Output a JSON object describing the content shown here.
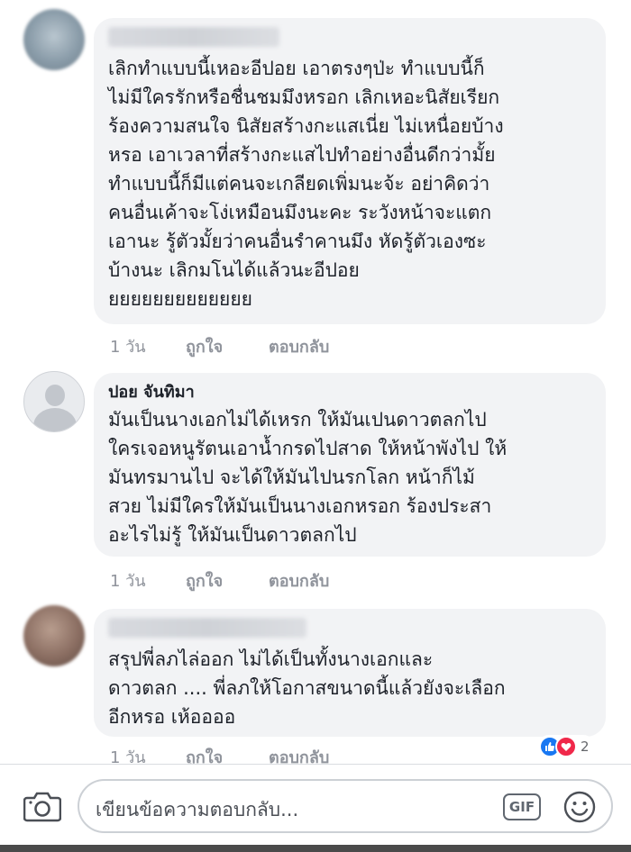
{
  "comments": [
    {
      "author": "",
      "author_hidden": true,
      "lines": [
        "เลิกทำแบบนี้เหอะอีปอย เอาตรงๆป่ะ ทำแบบนี้ก็",
        "ไม่มีใครรักหรือชื่นชมมึงหรอก เลิกเหอะนิสัยเรียก",
        "ร้องความสนใจ นิสัยสร้างกะแสเนี่ย ไม่เหนื่อยบ้าง",
        "หรอ เอาเวลาที่สร้างกะแสไปทำอย่างอื่นดีกว่ามั้ย",
        "ทำแบบนี้ก็มีแต่คนจะเกลียดเพิ่มนะจ้ะ อย่าคิดว่า",
        "คนอื่นเค้าจะโง่เหมือนมึงนะคะ ระวังหน้าจะแตก",
        "เอานะ รู้ตัวมั้ยว่าคนอื่นรำคานมึง หัดรู้ตัวเองซะ",
        "บ้างนะ เลิกมโนได้แล้วนะอีปอย",
        "ยยยยยยยยยยยยย"
      ],
      "time": "1 วัน",
      "like": "ถูกใจ",
      "reply": "ตอบกลับ"
    },
    {
      "author": "ปอย จันทิมา",
      "author_hidden": false,
      "lines": [
        "มันเป็นนางเอกไม่ได้เหรก ให้มันเปนดาวตลกไป",
        "ใครเจอหนูรัตนเอาน้ำกรดไปสาด ให้หน้าพังไป ให้",
        "มันทรมานไป จะได้ให้มันไปนรกโลก หน้าก็ไม้",
        "สวย ไม่มีใครให้มันเป็นนางเอกหรอก ร้องประสา",
        "อะไรไม่รู้ ให้มันเป็นดาวตลกไป"
      ],
      "time": "1 วัน",
      "like": "ถูกใจ",
      "reply": "ตอบกลับ"
    },
    {
      "author": "",
      "author_hidden": true,
      "lines": [
        "สรุปพี่ลภไล่ออก ไม่ได้เป็นทั้งนางเอกและ",
        "ดาวตลก .... พี่ลภให้โอกาสขนาดนี้แล้วยังจะเลือก",
        "อีกหรอ เห้ออออ"
      ],
      "time": "1 วัน",
      "like": "ถูกใจ",
      "reply": "ตอบกลับ",
      "reactions": {
        "count": "2",
        "types": [
          "like-icon",
          "love-icon"
        ]
      }
    }
  ],
  "composer": {
    "placeholder": "เขียนข้อความตอบกลับ...",
    "gif_label": "GIF",
    "icons": [
      "camera-icon",
      "gif-icon",
      "smiley-icon"
    ]
  },
  "colors": {
    "bubble": "#f2f3f5",
    "meta_text": "#90949c",
    "like_blue": "#1877f2",
    "love_red": "#f0284a"
  }
}
